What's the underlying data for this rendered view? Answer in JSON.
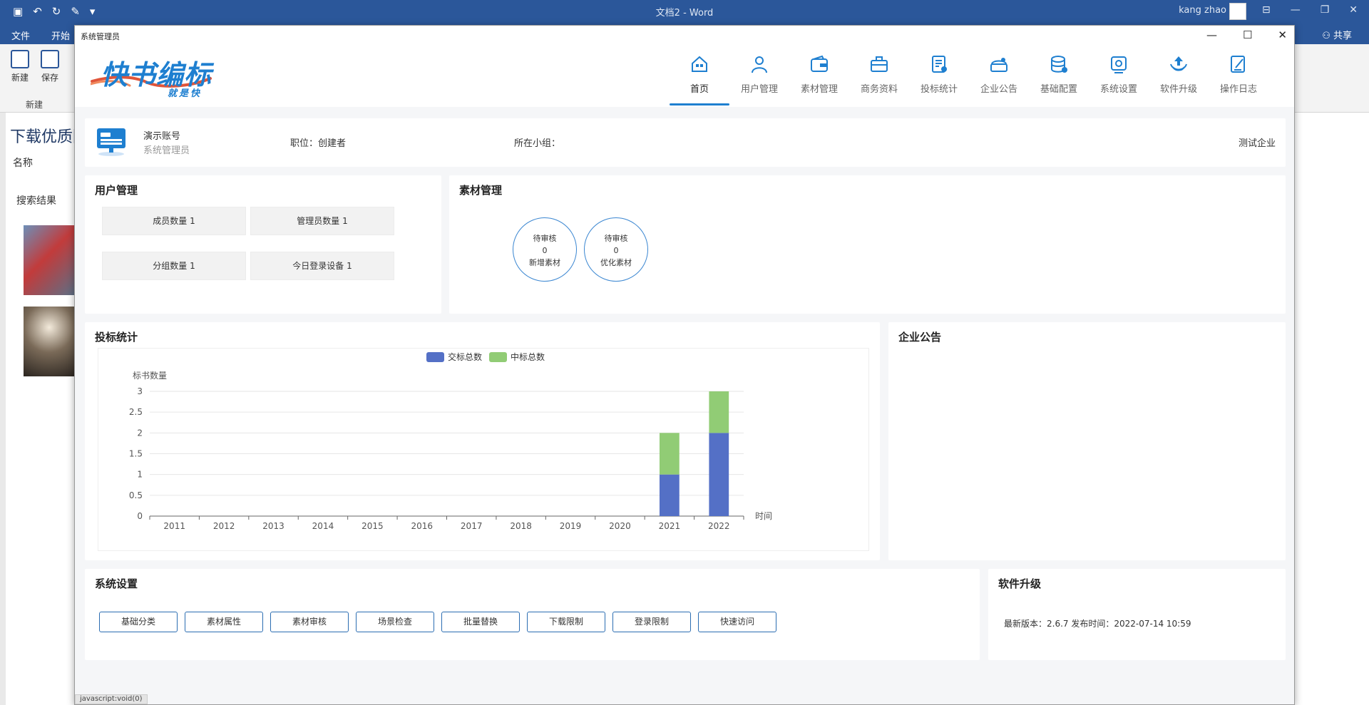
{
  "word": {
    "doc_title": "文档2  -  Word",
    "user_name": "kang zhao",
    "menu": [
      "文件",
      "开始"
    ],
    "share_label": "共享",
    "ribbon": {
      "new_label": "新建",
      "save_label": "保存",
      "group_label": "新建"
    },
    "doc": {
      "heading": "下载优质图",
      "name_label": "名称",
      "search_result_label": "搜索结果"
    }
  },
  "app": {
    "window_title": "系统管理员",
    "logo": {
      "main": "快书编标",
      "sub": "就是快"
    },
    "nav": [
      {
        "label": "首页",
        "icon": "home-icon",
        "active": true
      },
      {
        "label": "用户管理",
        "icon": "user-icon",
        "active": false
      },
      {
        "label": "素材管理",
        "icon": "wallet-icon",
        "active": false
      },
      {
        "label": "商务资料",
        "icon": "briefcase-icon",
        "active": false
      },
      {
        "label": "投标统计",
        "icon": "report-icon",
        "active": false
      },
      {
        "label": "企业公告",
        "icon": "notice-icon",
        "active": false
      },
      {
        "label": "基础配置",
        "icon": "database-icon",
        "active": false
      },
      {
        "label": "系统设置",
        "icon": "settings-icon",
        "active": false
      },
      {
        "label": "软件升级",
        "icon": "upgrade-icon",
        "active": false
      },
      {
        "label": "操作日志",
        "icon": "log-icon",
        "active": false
      }
    ],
    "account": {
      "name": "演示账号",
      "role": "系统管理员",
      "position": "职位：创建者",
      "group": "所在小组：",
      "company": "测试企业"
    },
    "user_mgmt": {
      "title": "用户管理",
      "stats": [
        "成员数量 1",
        "管理员数量 1",
        "分组数量 1",
        "今日登录设备 1"
      ]
    },
    "material_mgmt": {
      "title": "素材管理",
      "circles": [
        {
          "line1": "待审核",
          "value": "0",
          "line2": "新增素材"
        },
        {
          "line1": "待审核",
          "value": "0",
          "line2": "优化素材"
        }
      ]
    },
    "bid_stats": {
      "title": "投标统计"
    },
    "notice": {
      "title": "企业公告"
    },
    "settings": {
      "title": "系统设置",
      "buttons": [
        "基础分类",
        "素材属性",
        "素材审核",
        "场景检查",
        "批量替换",
        "下载限制",
        "登录限制",
        "快速访问"
      ]
    },
    "upgrade": {
      "title": "软件升级",
      "version_text": "最新版本：2.6.7    发布时间：2022-07-14 10:59"
    },
    "status_text": "javascript:void(0)"
  },
  "colors": {
    "accent": "#1e7fd0",
    "series1": "#5470c6",
    "series2": "#91cc75",
    "word_blue": "#2b579a"
  },
  "chart_data": {
    "type": "bar",
    "stacked": true,
    "categories": [
      "2011",
      "2012",
      "2013",
      "2014",
      "2015",
      "2016",
      "2017",
      "2018",
      "2019",
      "2020",
      "2021",
      "2022"
    ],
    "series": [
      {
        "name": "交标总数",
        "values": [
          0,
          0,
          0,
          0,
          0,
          0,
          0,
          0,
          0,
          0,
          1,
          2
        ]
      },
      {
        "name": "中标总数",
        "values": [
          0,
          0,
          0,
          0,
          0,
          0,
          0,
          0,
          0,
          0,
          1,
          1
        ]
      }
    ],
    "ylabel": "标书数量",
    "xlabel": "时间",
    "ylim": [
      0,
      3
    ],
    "yticks": [
      0,
      0.5,
      1,
      1.5,
      2,
      2.5,
      3
    ],
    "legend": "top-center",
    "grid": true
  }
}
